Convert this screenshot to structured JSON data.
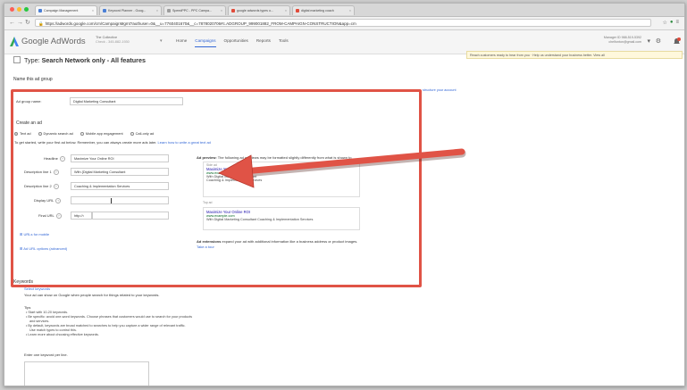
{
  "browser": {
    "tabs": [
      {
        "label": "Campaign Management",
        "active": true
      },
      {
        "label": "Keyword Planner - Goog..."
      },
      {
        "label": "SpeedPPC - PPC Campa..."
      },
      {
        "label": "google adwords types o..."
      },
      {
        "label": "digital marketing coach"
      }
    ],
    "url": "https://adwords.google.com/cm/CampaignMgmt?authuser=0&__u=7760401670&__c=7878020706#c.ADGROUP_999001882_FROM-CAMPAIGN-CONSTRUCTION&app=cm"
  },
  "header": {
    "logo": "Google AdWords",
    "account_name": "The Collective",
    "account_id": "Check - 345-882-1930",
    "nav": [
      {
        "label": "Home"
      },
      {
        "label": "Campaigns",
        "active": true
      },
      {
        "label": "Opportunities"
      },
      {
        "label": "Reports"
      },
      {
        "label": "Tools"
      }
    ],
    "manager_line1": "Manager ID 988-519-5392",
    "manager_line2": "chelfonton@gmail.com"
  },
  "type_line": {
    "prefix": "Type:",
    "value": "Search Network only - All features"
  },
  "notice": "Reach customers ready to hear from you  ·  Help us understand your business better.  View all",
  "adgroup_section": {
    "header": "Name this ad group",
    "structure_link": "structure your account",
    "name_label": "Ad group name:",
    "name_value": "Digital Marketing Consultant"
  },
  "create_ad": {
    "title": "Create an ad",
    "options": [
      {
        "label": "Text ad",
        "selected": true
      },
      {
        "label": "Dynamic search ad"
      },
      {
        "label": "Mobile app engagement"
      },
      {
        "label": "Call-only ad"
      }
    ],
    "intro": "To get started, write your first ad below. Remember, you can always create more ads later.",
    "intro_link": "Learn how to write a great text ad",
    "fields": [
      {
        "label": "Headline",
        "value": "Maximize Your Online ROI"
      },
      {
        "label": "Description line 1",
        "value": "With {Digital Marketing Consultant"
      },
      {
        "label": "Description line 2",
        "value": "Coaching & Implementation Services"
      },
      {
        "label": "Display URL",
        "value": ""
      },
      {
        "label": "Final URL",
        "value": "http://"
      }
    ],
    "final_url_prefix": "http://",
    "urls_mobile": "URLs for mobile",
    "url_options": "Ad URL options (advanced)"
  },
  "preview": {
    "heading": "Ad preview:",
    "heading_text": "The following ad previews may be formatted slightly differently from what is shown to",
    "side_label": "Side ad",
    "side": {
      "title": "Maximize Your Online ROI",
      "url": "www.example.com",
      "line1": "With Digital Marketing Consultant",
      "line2": "Coaching & Implementation Services"
    },
    "top_label": "Top ad",
    "top": {
      "title": "Maximize Your Online ROI",
      "url": "www.example.com",
      "line1": "With Digital Marketing Consultant Coaching & Implementation Services"
    },
    "extensions_bold": "Ad extensions",
    "extensions_text": "expand your ad with additional information like a business address or product images.",
    "tour_link": "Take a tour"
  },
  "keywords": {
    "title": "Keywords",
    "select_label": "Select keywords",
    "desc": "Your ad can show on Google when people search for things related to your keywords.",
    "tips_title": "Tips",
    "tips": [
      "Start with 10-20 keywords.",
      "Be specific: avoid one-word keywords. Choose phrases that customers would use to search for your products",
      "and services.",
      "By default, keywords are broad matched to searches to help you capture a wider range of relevant traffic.",
      "Use match types to control this.",
      "Learn more about choosing effective keywords."
    ],
    "enter_label": "Enter one keyword per line."
  },
  "colors": {
    "highlight": "#e05346",
    "accent": "#3367d6"
  }
}
